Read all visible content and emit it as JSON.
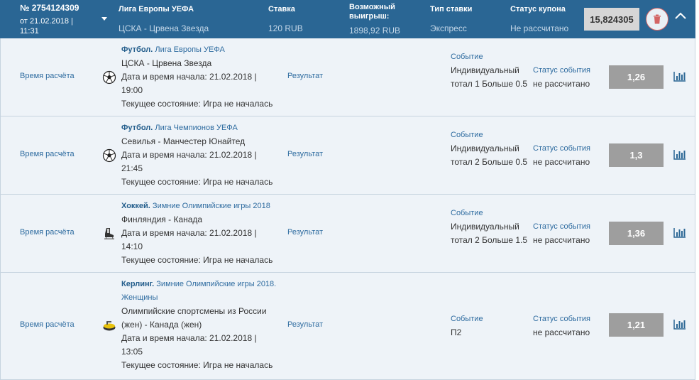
{
  "coupon": {
    "number": "№ 2754124309",
    "date": "от 21.02.2018 | 11:31",
    "league": "Лига Европы УЕФА",
    "match": "ЦСКА - Црвена Звезда",
    "stake_label": "Ставка",
    "stake_value": "120 RUB",
    "win_label": "Возможный выигрыш:",
    "win_value": "1898,92 RUB",
    "type_label": "Тип ставки",
    "type_value": "Экспресс",
    "status_label": "Статус купона",
    "status_value": "Не рассчитано",
    "total_coef": "15,824305"
  },
  "colors": {
    "header_bg": "#2a6694",
    "row_bg": "#eef3f8",
    "coef_bg": "#9e9e9e",
    "link": "#2f6ca0",
    "delete": "#d36464"
  },
  "icons": {
    "dropdown": "caret-down-icon",
    "delete": "trash-icon",
    "collapse": "chevron-up-icon",
    "stats": "bar-chart-icon"
  },
  "events": [
    {
      "calc": "Время расчёта",
      "sport": "Футбол.",
      "league": "Лига Европы УЕФА",
      "teams": "ЦСКА - Црвена Звезда",
      "start": "Дата и время начала: 21.02.2018 | 19:00",
      "state": "Текущее состояние: Игра не началась",
      "result": "Результат",
      "event_label": "Событие",
      "event": "Индивидуальный тотал 1 Больше 0.5",
      "status_label": "Статус события",
      "status": "не рассчитано",
      "coef": "1,26",
      "icon": "soccer-ball-icon"
    },
    {
      "calc": "Время расчёта",
      "sport": "Футбол.",
      "league": "Лига Чемпионов УЕФА",
      "teams": "Севилья - Манчестер Юнайтед",
      "start": "Дата и время начала: 21.02.2018 | 21:45",
      "state": "Текущее состояние: Игра не началась",
      "result": "Результат",
      "event_label": "Событие",
      "event": "Индивидуальный тотал 2 Больше 0.5",
      "status_label": "Статус события",
      "status": "не рассчитано",
      "coef": "1,3",
      "icon": "soccer-ball-icon"
    },
    {
      "calc": "Время расчёта",
      "sport": "Хоккей.",
      "league": "Зимние Олимпийские игры 2018",
      "teams": "Финляндия - Канада",
      "start": "Дата и время начала: 21.02.2018 | 14:10",
      "state": "Текущее состояние: Игра не началась",
      "result": "Результат",
      "event_label": "Событие",
      "event": "Индивидуальный тотал 2 Больше 1.5",
      "status_label": "Статус события",
      "status": "не рассчитано",
      "coef": "1,36",
      "icon": "ice-skate-icon"
    },
    {
      "calc": "Время расчёта",
      "sport": "Керлинг.",
      "league": "Зимние Олимпийские игры 2018. Женщины",
      "teams": "Олимпийские спортсмены из России (жен) - Канада (жен)",
      "start": "Дата и время начала: 21.02.2018 | 13:05",
      "state": "Текущее состояние: Игра не началась",
      "result": "Результат",
      "event_label": "Событие",
      "event": "П2",
      "status_label": "Статус события",
      "status": "не рассчитано",
      "coef": "1,21",
      "icon": "curling-stone-icon"
    }
  ]
}
